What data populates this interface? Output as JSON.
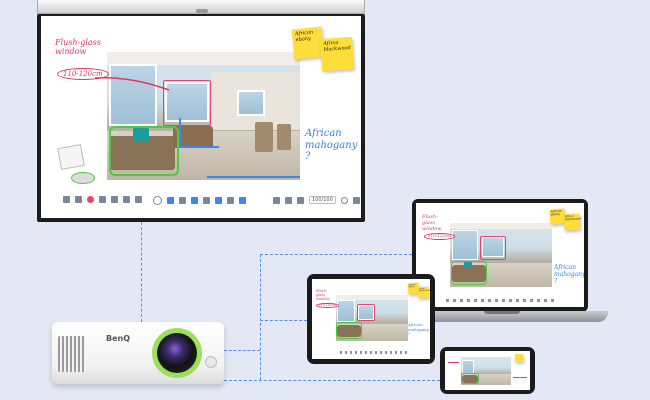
{
  "board": {
    "annotation_window": "Flush-glass window",
    "annotation_size": "110-120cm",
    "annotation_wood": "African mahogany ?",
    "sticky_notes": [
      "African ebony",
      "Africa blackwood"
    ],
    "zoom": "100/100"
  },
  "projector": {
    "brand": "BenQ"
  },
  "laptop": {
    "annotation_window": "Flush-glass window",
    "annotation_size": "110-120cm",
    "annotation_wood": "African mahogany ?",
    "sticky_notes": [
      "African ebony",
      "Africa blackwood"
    ]
  },
  "tablet": {
    "annotation_window": "Flush-glass window",
    "annotation_size": "110-120cm",
    "annotation_wood": "African mahogany ?",
    "sticky_notes": [
      "African ebony",
      "Africa blackwood"
    ]
  },
  "colors": {
    "accent_red": "#e0365f",
    "accent_blue": "#3a80e0",
    "highlight_green": "#4ccb3f",
    "note_yellow": "#ffde3b",
    "lens_ring": "#9be05a"
  }
}
